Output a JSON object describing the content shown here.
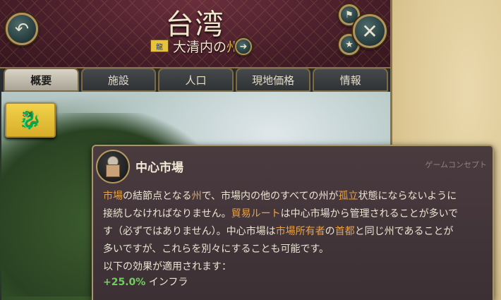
{
  "header": {
    "title": "台湾",
    "subtitle_parts": [
      "大清内の",
      "州"
    ],
    "back_icon": "undo-icon",
    "close_icon": "close-icon"
  },
  "tabs": [
    {
      "label": "概要",
      "active": true
    },
    {
      "label": "施設",
      "active": false
    },
    {
      "label": "人口",
      "active": false
    },
    {
      "label": "現地価格",
      "active": false
    },
    {
      "label": "情報",
      "active": false
    }
  ],
  "tooltip": {
    "title": "中心市場",
    "category": "ゲームコンセプト",
    "line1": [
      "市場",
      "の結節点となる",
      "州",
      "で、市場内の他のすべての州が",
      "孤立",
      "状態にならないように"
    ],
    "line2": [
      "接続しなければなりません。",
      "貿易ルート",
      "は中心市場から管理されることが多いで"
    ],
    "line3": [
      "す（必ずではありません）。中心市場は",
      "市場所有者",
      "の",
      "首都",
      "と同じ州であることが"
    ],
    "line4": "多いですが、これらを別々にすることも可能です。",
    "line5": "以下の効果が適用されます：",
    "effect_value": "+25.0%",
    "effect_label": "インフラ"
  },
  "colors": {
    "highlight": "#e6a24a",
    "positive": "#6fcf5d",
    "header_bg": "#4a1f2b"
  }
}
